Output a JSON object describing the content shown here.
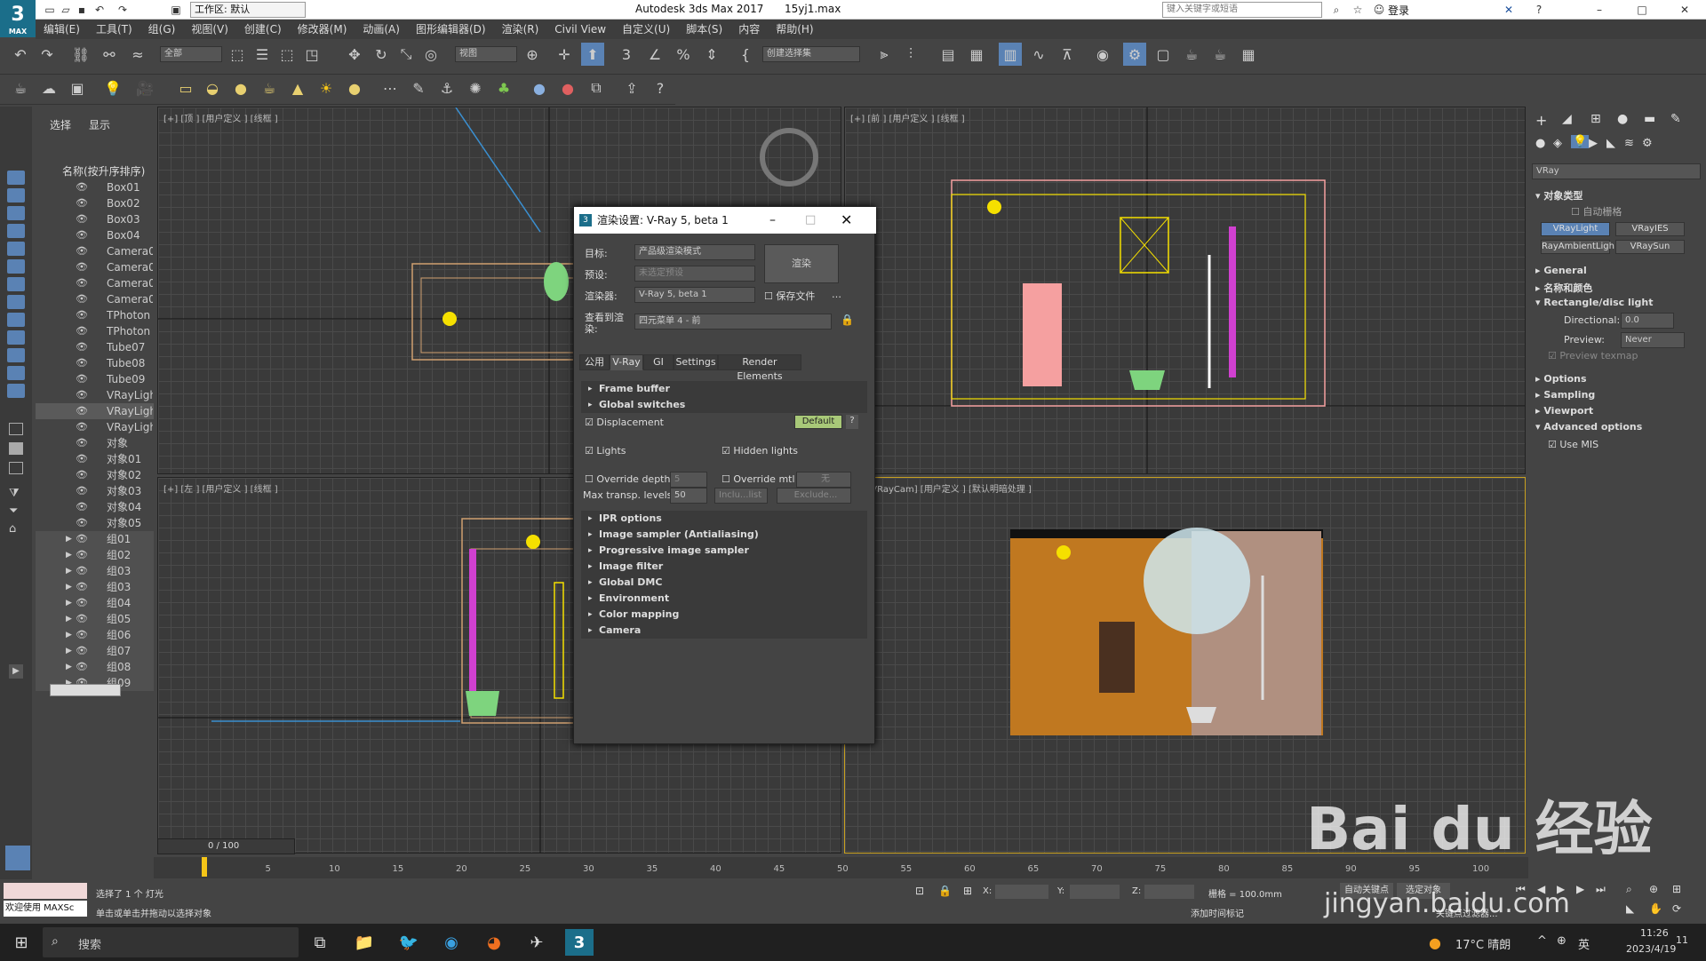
{
  "titlebar": {
    "workspace": "工作区: 默认",
    "app_title": "Autodesk 3ds Max 2017",
    "file_name": "15yj1.max",
    "search_placeholder": "键入关键字或短语",
    "login": "登录",
    "logo": "3",
    "logo_sub": "MAX"
  },
  "menu": [
    "编辑(E)",
    "工具(T)",
    "组(G)",
    "视图(V)",
    "创建(C)",
    "修改器(M)",
    "动画(A)",
    "图形编辑器(D)",
    "渲染(R)",
    "Civil View",
    "自定义(U)",
    "脚本(S)",
    "内容",
    "帮助(H)"
  ],
  "toolbar": {
    "filter": "全部",
    "view": "视图",
    "selection_set": "创建选择集"
  },
  "scene_explorer": {
    "tab_select": "选择",
    "tab_display": "显示",
    "header": "名称(按升序排序)",
    "items": [
      "Box01",
      "Box02",
      "Box03",
      "Box04",
      "Camera0",
      "Camera0",
      "Camera0",
      "Camera0",
      "TPhoton",
      "TPhoton",
      "Tube07",
      "Tube08",
      "Tube09",
      "VRayLigh",
      "VRayLigh",
      "VRayLigh",
      "对象",
      "对象01",
      "对象02",
      "对象03",
      "对象04",
      "对象05"
    ],
    "groups": [
      "组01",
      "组02",
      "组03",
      "组03",
      "组04",
      "组05",
      "组06",
      "组07",
      "组08",
      "组09"
    ]
  },
  "viewports": {
    "top": "[+] [顶 ] [用户定义 ] [线框 ]",
    "front": "[+] [前 ] [用户定义 ] [线框 ]",
    "left": "[+] [左 ] [用户定义 ] [线框 ]",
    "camera": "[+] [VRayCam] [用户定义 ] [默认明暗处理 ]"
  },
  "dialog": {
    "title": "渲染设置: V-Ray 5, beta 1",
    "target_label": "目标:",
    "target_value": "产品级渲染模式",
    "preset_label": "预设:",
    "preset_value": "未选定预设",
    "renderer_label": "渲染器:",
    "renderer_value": "V-Ray 5, beta 1",
    "save_file": "保存文件",
    "view_label": "查看到渲染:",
    "view_value": "四元菜单 4 - 前",
    "render_button": "渲染",
    "tabs": [
      "公用",
      "V-Ray",
      "GI",
      "Settings",
      "Render Elements"
    ],
    "frame_buffer": "Frame buffer",
    "global_switches": "Global switches",
    "displacement": "Displacement",
    "default_btn": "Default",
    "help_btn": "?",
    "lights": "Lights",
    "hidden_lights": "Hidden lights",
    "override_depth": "Override depth",
    "override_depth_val": "5",
    "override_mtl": "Override mtl",
    "none_btn": "无",
    "max_transp": "Max transp. levels",
    "max_transp_val": "50",
    "include_list": "Inclu...list",
    "exclude_btn": "Exclude...",
    "rollouts": [
      "IPR options",
      "Image sampler (Antialiasing)",
      "Progressive image sampler",
      "Image filter",
      "Global DMC",
      "Environment",
      "Color mapping",
      "Camera"
    ]
  },
  "command_panel": {
    "dropdown": "VRay",
    "object_type": "对象类型",
    "auto_grid": "自动栅格",
    "buttons": [
      "VRayLight",
      "VRayIES",
      "RayAmbientLigh",
      "VRaySun"
    ],
    "name_color": "名称和颜色",
    "general": "General",
    "rect_disc": "Rectangle/disc light",
    "directional_label": "Directional:",
    "directional_val": "0.0",
    "preview_label": "Preview:",
    "preview_val": "Never",
    "preview_texmap": "Preview texmap",
    "sections": [
      "Options",
      "Sampling",
      "Viewport",
      "Advanced options"
    ],
    "use_mis": "Use MIS"
  },
  "timeline": {
    "frame": "0 / 100",
    "ticks": [
      "0",
      "5",
      "10",
      "15",
      "20",
      "25",
      "30",
      "35",
      "40",
      "45",
      "50",
      "55",
      "60",
      "65",
      "70",
      "75",
      "80",
      "85",
      "90",
      "95",
      "100"
    ]
  },
  "status": {
    "maxscript": "欢迎使用 MAXSc",
    "selected": "选择了 1 个 灯光",
    "prompt": "单击或单击并拖动以选择对象",
    "x": "X:",
    "y": "Y:",
    "z": "Z:",
    "grid": "栅格 = 100.0mm",
    "auto_key": "自动关键点",
    "selected_obj": "选定对象",
    "add_time_tag": "添加时间标记",
    "key_filter": "关键点过滤器..."
  },
  "taskbar": {
    "search": "搜索",
    "weather": "17°C 晴朗",
    "lang": "英",
    "time": "11:26",
    "date": "2023/4/19",
    "notif": "11"
  },
  "watermark": {
    "brand": "Bai du 经验",
    "url": "jingyan.baidu.com"
  }
}
